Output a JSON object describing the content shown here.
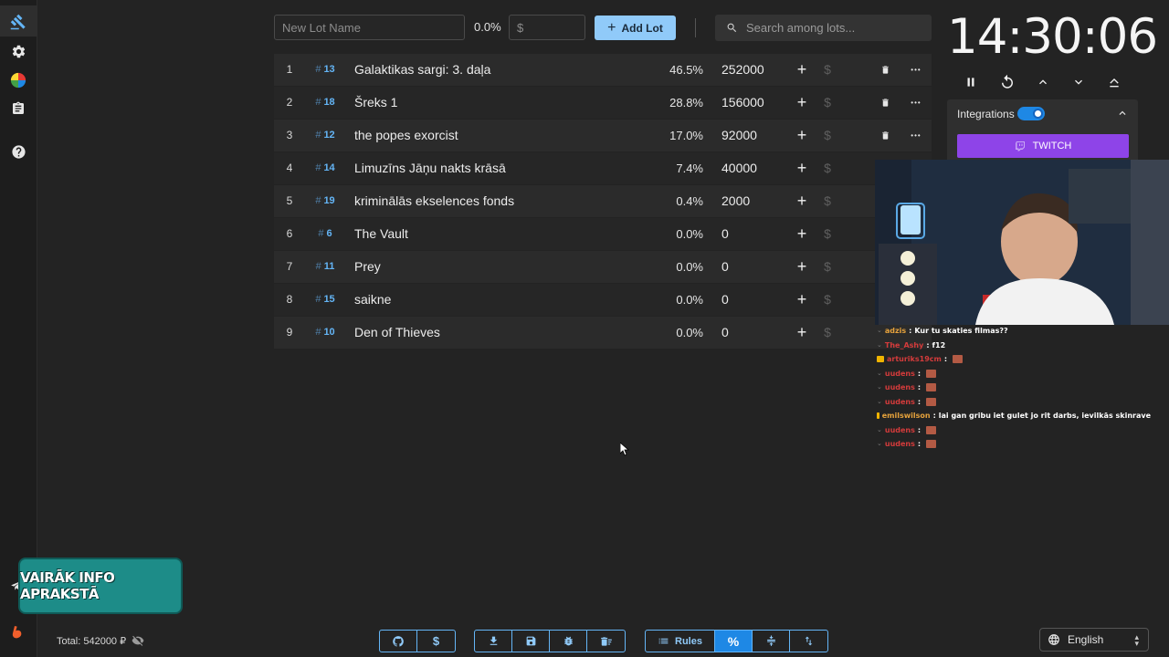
{
  "sidebar": {
    "icons": [
      "gavel-icon",
      "gear-icon",
      "pie-chart-icon",
      "clipboard-icon",
      "help-icon",
      "telegram-icon",
      "boosty-icon"
    ]
  },
  "toolbar": {
    "lot_name_placeholder": "New Lot Name",
    "percent": "0.0%",
    "amount_placeholder": "$",
    "add_label": "Add Lot",
    "search_placeholder": "Search among lots..."
  },
  "lots": [
    {
      "index": "1",
      "id": "13",
      "name": "Galaktikas sargi: 3. daļa",
      "percent": "46.5%",
      "amount": "252000"
    },
    {
      "index": "2",
      "id": "18",
      "name": "Šreks 1",
      "percent": "28.8%",
      "amount": "156000"
    },
    {
      "index": "3",
      "id": "12",
      "name": "the popes exorcist",
      "percent": "17.0%",
      "amount": "92000"
    },
    {
      "index": "4",
      "id": "14",
      "name": "Limuzīns Jāņu nakts krāsā",
      "percent": "7.4%",
      "amount": "40000"
    },
    {
      "index": "5",
      "id": "19",
      "name": "kriminālās ekselences fonds",
      "percent": "0.4%",
      "amount": "2000"
    },
    {
      "index": "6",
      "id": "6",
      "name": "The Vault",
      "percent": "0.0%",
      "amount": "0"
    },
    {
      "index": "7",
      "id": "11",
      "name": "Prey",
      "percent": "0.0%",
      "amount": "0"
    },
    {
      "index": "8",
      "id": "15",
      "name": "saikne",
      "percent": "0.0%",
      "amount": "0"
    },
    {
      "index": "9",
      "id": "10",
      "name": "Den of Thieves",
      "percent": "0.0%",
      "amount": "0"
    }
  ],
  "lot_symbols": {
    "hash": "#",
    "plus": "+",
    "dollar": "$",
    "more": "•••"
  },
  "timer": {
    "display": "14:30:06"
  },
  "integrations": {
    "label": "Integrations",
    "twitch_label": "TWITCH",
    "enabled": true
  },
  "chat": [
    {
      "user": "adzis",
      "color": "#e6a23c",
      "msg": "Kur tu skaties filmas??"
    },
    {
      "user": "The_Ashy",
      "color": "#d43b3b",
      "msg": "f12"
    },
    {
      "user": "arturiks19cm",
      "color": "#d43b3b",
      "msg": ""
    },
    {
      "user": "uudens",
      "color": "#d43b3b",
      "msg": ""
    },
    {
      "user": "uudens",
      "color": "#d43b3b",
      "msg": ""
    },
    {
      "user": "uudens",
      "color": "#d43b3b",
      "msg": ""
    },
    {
      "user": "emilswilson",
      "color": "#e6a23c",
      "msg": "lai gan gribu iet gulet jo rit darbs, ievilkās skinrave"
    },
    {
      "user": "uudens",
      "color": "#d43b3b",
      "msg": ""
    },
    {
      "user": "uudens",
      "color": "#d43b3b",
      "msg": ""
    }
  ],
  "promo": {
    "text": "VAIRĀK INFO APRAKSTĀ"
  },
  "footer": {
    "total": "Total: 542000 ₽",
    "rules_label": "Rules",
    "language": "English"
  },
  "colors": {
    "accent": "#90caf9",
    "primary": "#1e88e5",
    "twitch": "#8e44e8",
    "background": "#232323"
  }
}
